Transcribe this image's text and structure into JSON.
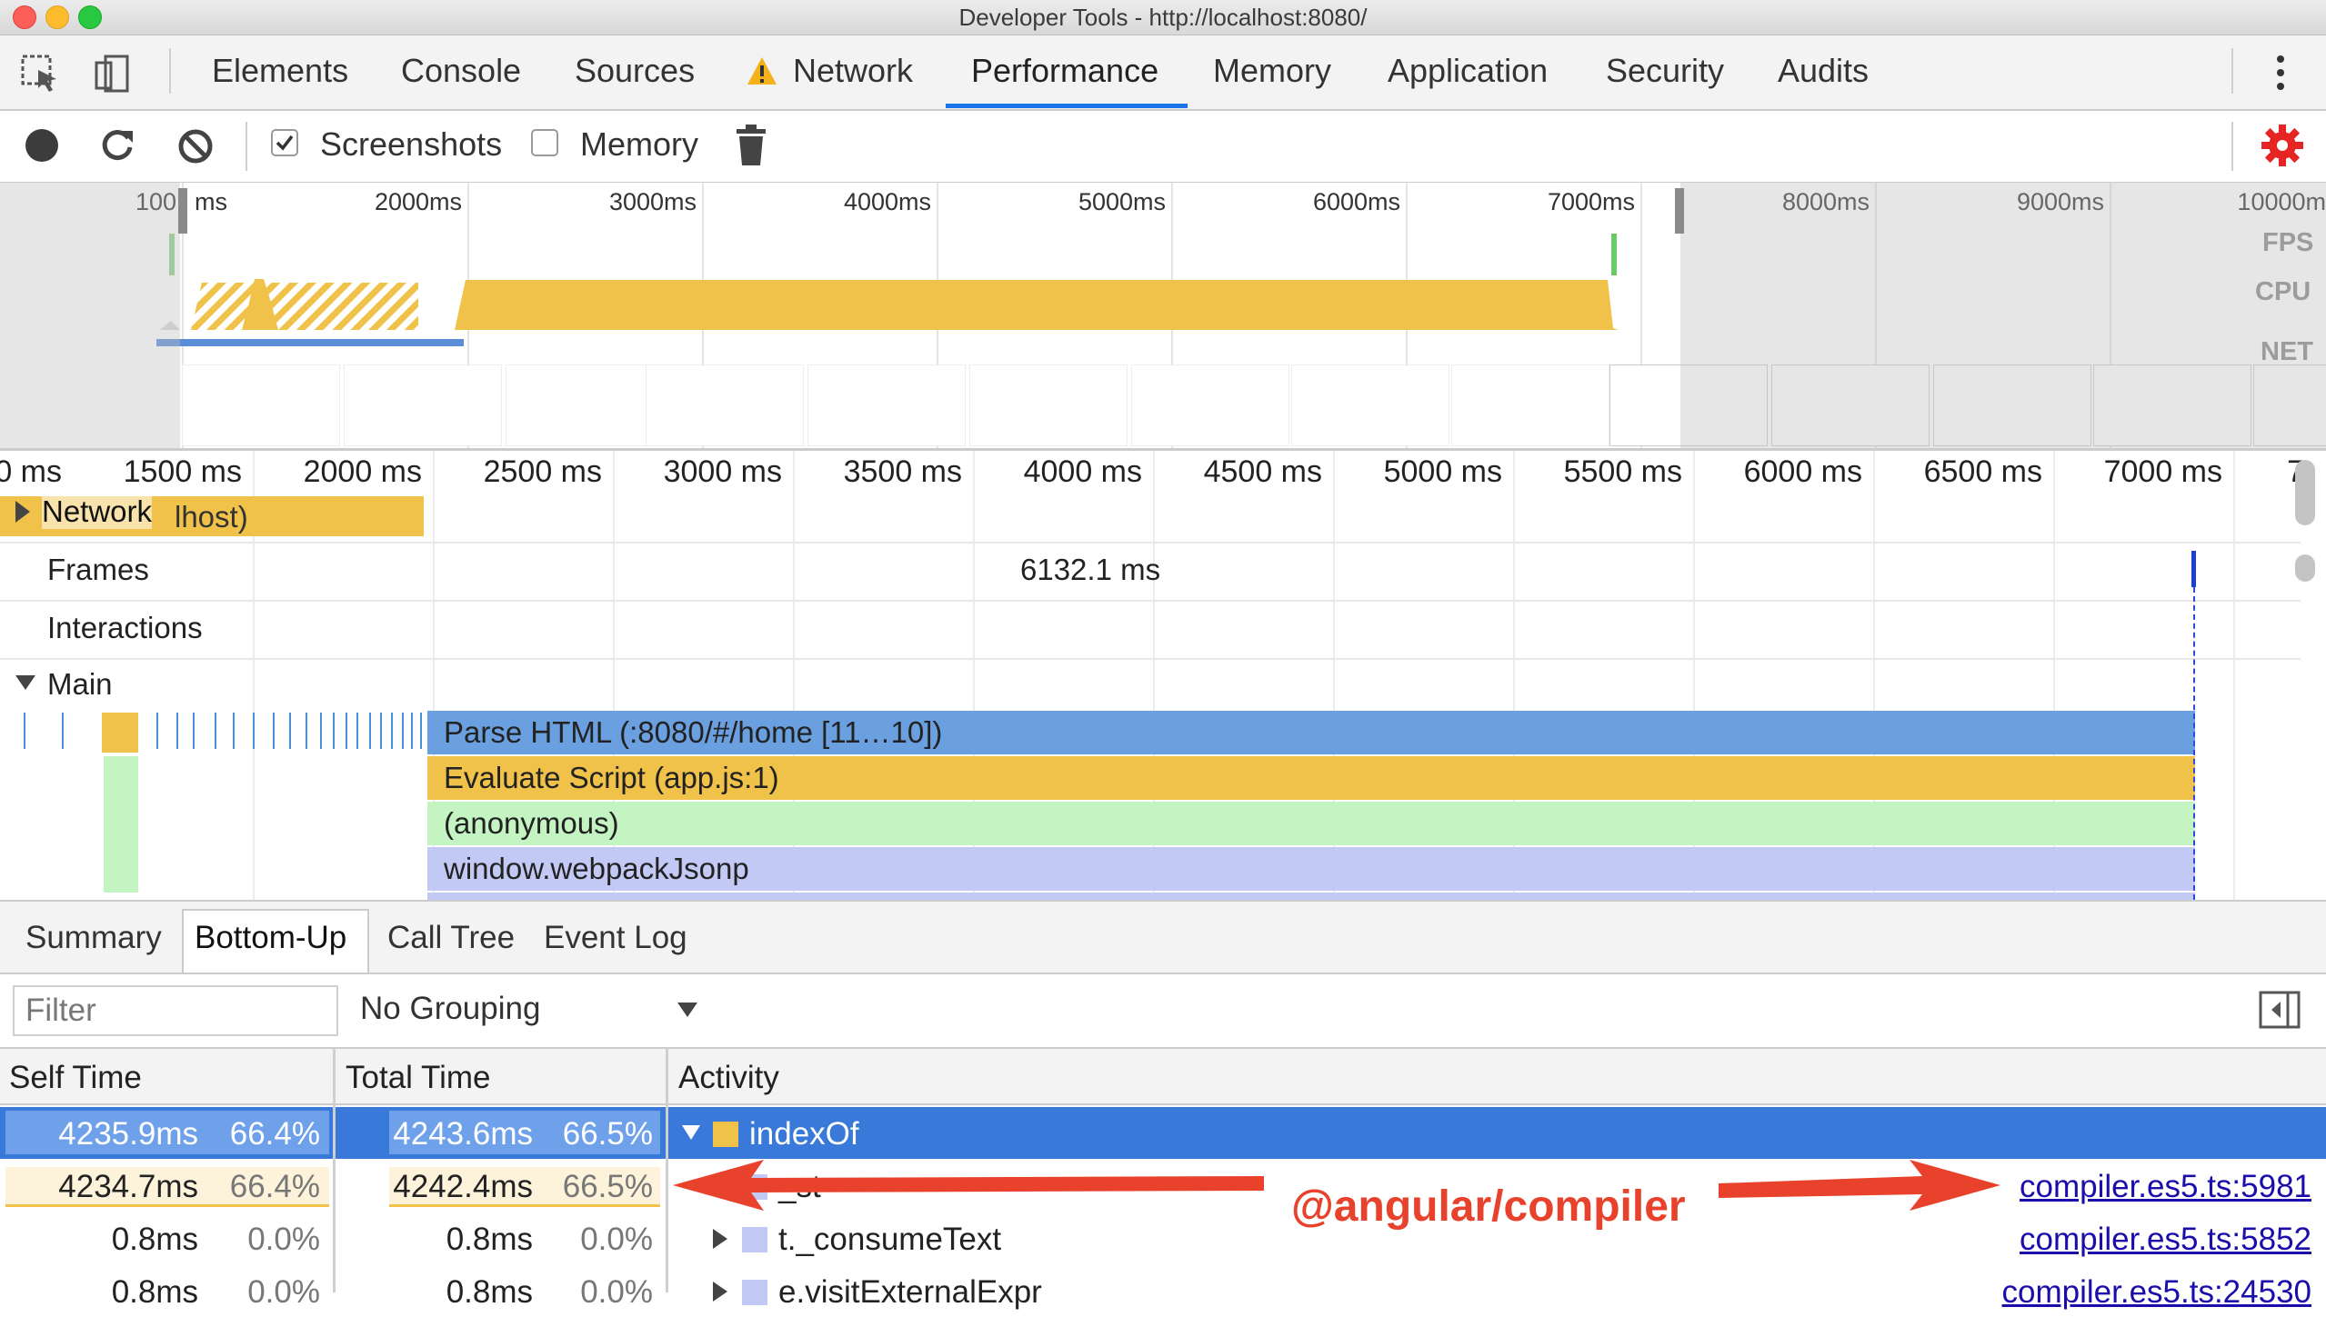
{
  "window": {
    "title": "Developer Tools - http://localhost:8080/"
  },
  "tabs": [
    {
      "label": "Elements"
    },
    {
      "label": "Console"
    },
    {
      "label": "Sources"
    },
    {
      "label": "Network",
      "warning": true
    },
    {
      "label": "Performance",
      "active": true
    },
    {
      "label": "Memory"
    },
    {
      "label": "Application"
    },
    {
      "label": "Security"
    },
    {
      "label": "Audits"
    }
  ],
  "controls": {
    "screenshots_label": "Screenshots",
    "screenshots_checked": true,
    "memory_label": "Memory",
    "memory_checked": false
  },
  "overview": {
    "ticks": [
      "100",
      "ms",
      "2000ms",
      "3000ms",
      "4000ms",
      "5000ms",
      "6000ms",
      "7000ms",
      "8000ms",
      "9000ms",
      "10000m"
    ],
    "lanes": [
      "FPS",
      "CPU",
      "NET"
    ]
  },
  "flame": {
    "ticks": [
      "0 ms",
      "1500 ms",
      "2000 ms",
      "2500 ms",
      "3000 ms",
      "3500 ms",
      "4000 ms",
      "4500 ms",
      "5000 ms",
      "5500 ms",
      "6000 ms",
      "6500 ms",
      "7000 ms",
      "7"
    ],
    "network_label": "Network",
    "network_bar_text": "lhost)",
    "frames_label": "Frames",
    "frames_value": "6132.1 ms",
    "interactions_label": "Interactions",
    "main_label": "Main",
    "bars": [
      {
        "text": "Parse HTML (:8080/#/home [11…10])",
        "color": "#6a9fe0"
      },
      {
        "text": "Evaluate Script (app.js:1)",
        "color": "#f0c24a"
      },
      {
        "text": "(anonymous)",
        "color": "#c3f4c2"
      },
      {
        "text": "window.webpackJsonp",
        "color": "#c3c9f5"
      }
    ]
  },
  "bottom_tabs": [
    {
      "label": "Summary"
    },
    {
      "label": "Bottom-Up",
      "active": true
    },
    {
      "label": "Call Tree"
    },
    {
      "label": "Event Log"
    }
  ],
  "filter": {
    "placeholder": "Filter",
    "grouping": "No Grouping"
  },
  "table": {
    "headers": {
      "self": "Self Time",
      "total": "Total Time",
      "activity": "Activity"
    },
    "rows": [
      {
        "self_time": "4235.9ms",
        "self_pct": "66.4%",
        "total_time": "4243.6ms",
        "total_pct": "66.5%",
        "name": "indexOf",
        "source": "",
        "selected": true,
        "color": "#f0c24a",
        "self_fraction": 0.664,
        "total_fraction": 0.665
      },
      {
        "self_time": "4234.7ms",
        "self_pct": "66.4%",
        "total_time": "4242.4ms",
        "total_pct": "66.5%",
        "name": "_st",
        "source": "compiler.es5.ts:5981",
        "selected": false,
        "color": "#c3c9f5",
        "self_fraction": 0.664,
        "total_fraction": 0.665
      },
      {
        "self_time": "0.8ms",
        "self_pct": "0.0%",
        "total_time": "0.8ms",
        "total_pct": "0.0%",
        "name": "t._consumeText",
        "source": "compiler.es5.ts:5852",
        "selected": false,
        "color": "#c3c9f5",
        "self_fraction": 0,
        "total_fraction": 0
      },
      {
        "self_time": "0.8ms",
        "self_pct": "0.0%",
        "total_time": "0.8ms",
        "total_pct": "0.0%",
        "name": "e.visitExternalExpr",
        "source": "compiler.es5.ts:24530",
        "selected": false,
        "color": "#c3c9f5",
        "self_fraction": 0,
        "total_fraction": 0
      }
    ]
  },
  "annotation": {
    "text": "@angular/compiler",
    "color": "#e8422c"
  }
}
